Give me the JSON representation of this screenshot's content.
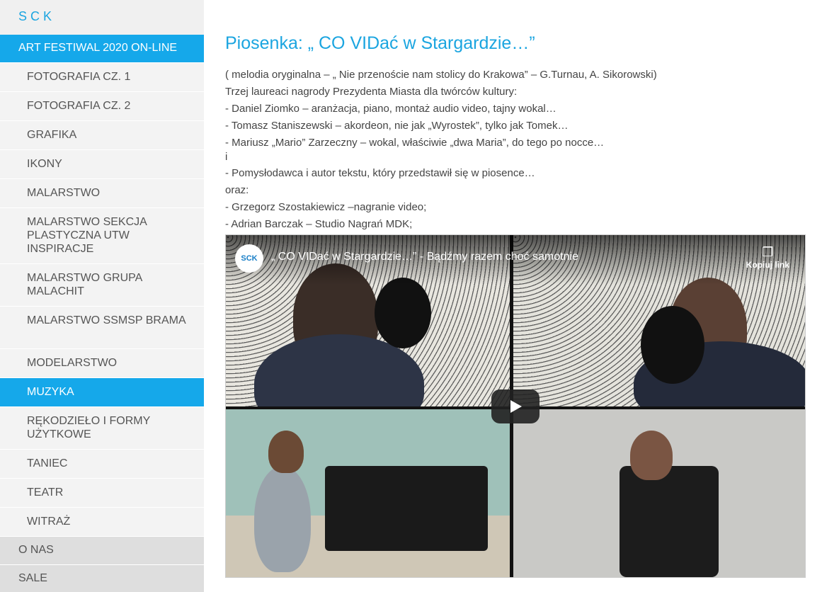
{
  "sidebar": {
    "brand": "SCK",
    "festival": "ART FESTIWAL 2020 ON-LINE",
    "items": [
      {
        "label": "FOTOGRAFIA CZ. 1"
      },
      {
        "label": "FOTOGRAFIA CZ. 2"
      },
      {
        "label": "GRAFIKA"
      },
      {
        "label": "IKONY"
      },
      {
        "label": "MALARSTWO"
      },
      {
        "label": "MALARSTWO SEKCJA PLASTYCZNA UTW INSPIRACJE"
      },
      {
        "label": "MALARSTWO GRUPA MALACHIT"
      },
      {
        "label": "MALARSTWO SSMSP BRAMA"
      },
      {
        "label": "MODELARSTWO"
      },
      {
        "label": "MUZYKA"
      },
      {
        "label": "RĘKODZIEŁO i FORMY UŻYTKOWE"
      },
      {
        "label": "TANIEC"
      },
      {
        "label": "TEATR"
      },
      {
        "label": "WITRAŻ"
      }
    ],
    "about": "O NAS",
    "halls": "SALE"
  },
  "main": {
    "title": "Piosenka: „ CO VIDać w Stargardzie…”",
    "lines": [
      "( melodia oryginalna – „ Nie przenoście nam stolicy do Krakowa” – G.Turnau, A. Sikorowski)",
      "Trzej laureaci nagrody Prezydenta Miasta dla twórców kultury:",
      "- Daniel Ziomko – aranżacja, piano, montaż audio video, tajny wokal…",
      "- Tomasz Staniszewski – akordeon, nie jak „Wyrostek”, tylko jak Tomek…",
      "- Mariusz „Mario” Zarzeczny – wokal, właściwie „dwa Maria”, do tego po nocce…",
      "i",
      "- Pomysłodawca i autor tekstu, który przedstawił się w piosence…",
      "oraz:",
      "- Grzegorz Szostakiewicz –nagranie video;",
      "- Adrian Barczak – Studio Nagrań MDK;"
    ]
  },
  "video": {
    "logo_text": "SCK",
    "title": "„ CO VIDać w Stargardzie…” - Bądźmy razem choć samotnie",
    "copy_label": "Kopiuj link",
    "copy_icon": "copy-icon",
    "play_icon": "play-icon"
  },
  "colors": {
    "accent": "#15a8ea",
    "sidebar_bg": "#f0f0f0"
  }
}
